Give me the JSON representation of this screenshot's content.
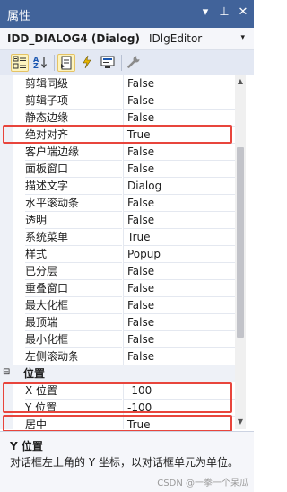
{
  "panel": {
    "title": "属性",
    "buttons": {
      "dropdown": "▾",
      "pin": "⊥",
      "close": "✕"
    }
  },
  "object": {
    "name": "IDD_DIALOG4 (Dialog)",
    "type": "IDlgEditor",
    "caret": "▾"
  },
  "toolbar": {
    "icons": [
      "categorized-icon",
      "alphabetical-icon",
      "properties-icon",
      "events-icon",
      "messages-icon",
      "property-pages-icon"
    ],
    "selected": [
      "categorized-icon",
      "properties-icon"
    ]
  },
  "properties": [
    {
      "name": "剪辑同级",
      "value": "False"
    },
    {
      "name": "剪辑子项",
      "value": "False"
    },
    {
      "name": "静态边缘",
      "value": "False"
    },
    {
      "name": "绝对对齐",
      "value": "True"
    },
    {
      "name": "客户端边缘",
      "value": "False"
    },
    {
      "name": "面板窗口",
      "value": "False"
    },
    {
      "name": "描述文字",
      "value": "Dialog"
    },
    {
      "name": "水平滚动条",
      "value": "False"
    },
    {
      "name": "透明",
      "value": "False"
    },
    {
      "name": "系统菜单",
      "value": "True"
    },
    {
      "name": "样式",
      "value": "Popup"
    },
    {
      "name": "已分层",
      "value": "False"
    },
    {
      "name": "重叠窗口",
      "value": "False"
    },
    {
      "name": "最大化框",
      "value": "False"
    },
    {
      "name": "最顶端",
      "value": "False"
    },
    {
      "name": "最小化框",
      "value": "False"
    },
    {
      "name": "左侧滚动条",
      "value": "False"
    }
  ],
  "category": {
    "toggle": "⊟",
    "label": "位置"
  },
  "position_properties": [
    {
      "name": "X 位置",
      "value": "-100"
    },
    {
      "name": "Y 位置",
      "value": "-100"
    },
    {
      "name": "居中",
      "value": "True"
    }
  ],
  "scrollbar": {
    "up": "▲",
    "down": "▼"
  },
  "description": {
    "title": "Y 位置",
    "text": "对话框左上角的 Y 坐标，以对话框单元为单位。"
  },
  "watermark": "CSDN @一拳一个呆瓜",
  "colors": {
    "title_bar": "#41639a",
    "highlight_box": "#e8453c",
    "selected_tool": "#fdf4bf"
  }
}
